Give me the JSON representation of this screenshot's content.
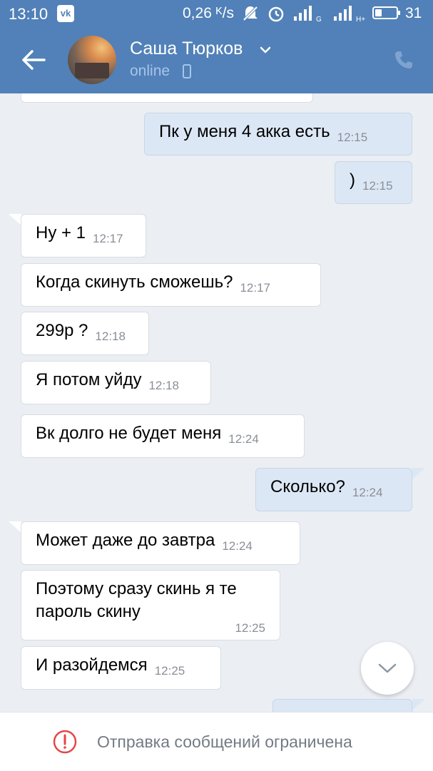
{
  "status_bar": {
    "time": "13:10",
    "network_speed": "0,26 ᴷ/s",
    "battery_level": "31",
    "battery_fraction": 0.31,
    "icons": [
      "vk-icon",
      "mute-icon",
      "alarm-icon",
      "signal-icon",
      "signal-icon",
      "battery-icon"
    ]
  },
  "header": {
    "contact_name": "Саша Тюрков",
    "status": "online"
  },
  "messages": [
    {
      "direction": "out",
      "text": "Пк у меня 4 акка есть",
      "time": "12:15"
    },
    {
      "direction": "out",
      "text": ")",
      "time": "12:15"
    },
    {
      "direction": "in",
      "text": "Ну + 1",
      "time": "12:17"
    },
    {
      "direction": "in",
      "text": "Когда скинуть сможешь?",
      "time": "12:17"
    },
    {
      "direction": "in",
      "text": "299р ?",
      "time": "12:18"
    },
    {
      "direction": "in",
      "text": "Я потом уйду",
      "time": "12:18"
    },
    {
      "direction": "in",
      "text": "Вк долго не будет меня",
      "time": "12:24"
    },
    {
      "direction": "out",
      "text": "Сколько?",
      "time": "12:24"
    },
    {
      "direction": "in",
      "text": "Может даже до завтра",
      "time": "12:24"
    },
    {
      "direction": "in",
      "text": "Поэтому сразу скинь я те",
      "text2": "пароль скину",
      "time": "12:25"
    },
    {
      "direction": "in",
      "text": "И разойдемся",
      "time": "12:25"
    }
  ],
  "footer": {
    "restriction_text": "Отправка сообщений ограничена"
  },
  "colors": {
    "header_bg": "#5181b8",
    "chat_bg": "#ebeef2",
    "incoming_bubble": "#ffffff",
    "outgoing_bubble": "#dce7f5",
    "warning_red": "#e64646"
  }
}
